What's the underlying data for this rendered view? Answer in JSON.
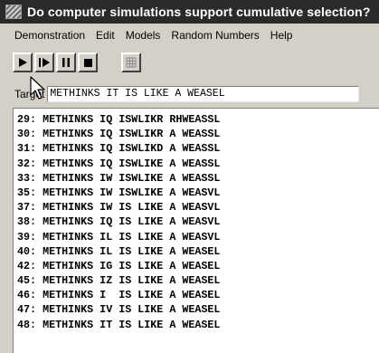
{
  "window": {
    "title": "Do computer simulations support cumulative selection?"
  },
  "menubar": {
    "items": [
      "Demonstration",
      "Edit",
      "Models",
      "Random Numbers",
      "Help"
    ]
  },
  "toolbar": {
    "buttons": [
      {
        "icon": "play-icon"
      },
      {
        "icon": "step-icon"
      },
      {
        "icon": "pause-icon"
      },
      {
        "icon": "stop-icon"
      },
      {
        "icon": "grid-icon"
      }
    ]
  },
  "target": {
    "label": "Target",
    "value": "METHINKS IT IS LIKE A WEASEL"
  },
  "generations": [
    {
      "gen": "29",
      "text": "METHINKS IQ ISWLIKR RHWEASSL"
    },
    {
      "gen": "30",
      "text": "METHINKS IQ ISWLIKR A WEASSL"
    },
    {
      "gen": "31",
      "text": "METHINKS IQ ISWLIKD A WEASSL"
    },
    {
      "gen": "32",
      "text": "METHINKS IQ ISWLIKE A WEASSL"
    },
    {
      "gen": "33",
      "text": "METHINKS IW ISWLIKE A WEASSL"
    },
    {
      "gen": "35",
      "text": "METHINKS IW ISWLIKE A WEASVL"
    },
    {
      "gen": "37",
      "text": "METHINKS IW IS LIKE A WEASVL"
    },
    {
      "gen": "38",
      "text": "METHINKS IQ IS LIKE A WEASVL"
    },
    {
      "gen": "39",
      "text": "METHINKS IL IS LIKE A WEASVL"
    },
    {
      "gen": "40",
      "text": "METHINKS IL IS LIKE A WEASEL"
    },
    {
      "gen": "42",
      "text": "METHINKS IG IS LIKE A WEASEL"
    },
    {
      "gen": "45",
      "text": "METHINKS IZ IS LIKE A WEASEL"
    },
    {
      "gen": "46",
      "text": "METHINKS I  IS LIKE A WEASEL"
    },
    {
      "gen": "47",
      "text": "METHINKS IV IS LIKE A WEASEL"
    },
    {
      "gen": "48",
      "text": "METHINKS IT IS LIKE A WEASEL"
    }
  ],
  "colors": {
    "titlebar": "#2a2a2a",
    "chrome": "#d4d0c8",
    "text": "#000000"
  }
}
